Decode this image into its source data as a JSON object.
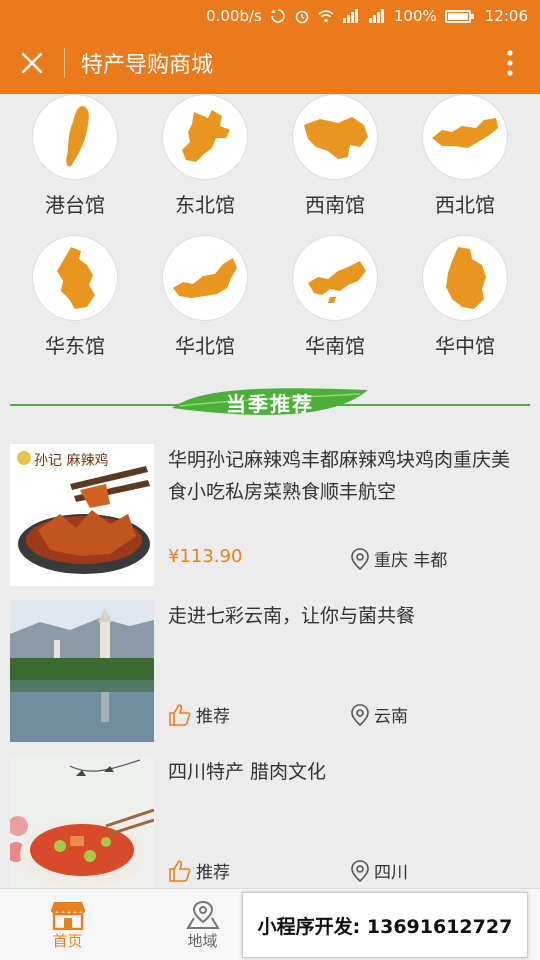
{
  "status_bar": {
    "speed": "0.00b/s",
    "battery": "100%",
    "time": "12:06"
  },
  "header": {
    "title": "特产导购商城",
    "background": "#ea7a1b"
  },
  "regions": [
    {
      "label": "港台馆",
      "icon": "taiwan-map-icon"
    },
    {
      "label": "东北馆",
      "icon": "northeast-map-icon"
    },
    {
      "label": "西南馆",
      "icon": "southwest-map-icon"
    },
    {
      "label": "西北馆",
      "icon": "northwest-map-icon"
    },
    {
      "label": "华东馆",
      "icon": "east-china-map-icon"
    },
    {
      "label": "华北馆",
      "icon": "north-china-map-icon"
    },
    {
      "label": "华南馆",
      "icon": "south-china-map-icon"
    },
    {
      "label": "华中馆",
      "icon": "central-china-map-icon"
    }
  ],
  "section": {
    "title": "当季推荐",
    "accent": "#4caf3a"
  },
  "products": [
    {
      "name": "华明孙记麻辣鸡丰都麻辣鸡块鸡肉重庆美食小吃私房菜熟食顺丰航空",
      "price": "¥113.90",
      "location": "重庆 丰都",
      "thumb_text": "孙记 麻辣鸡"
    },
    {
      "name": "走进七彩云南，让你与菌共餐",
      "tag": "推荐",
      "location": "云南"
    },
    {
      "name": "四川特产 腊肉文化",
      "tag": "推荐",
      "location": "四川"
    }
  ],
  "tabbar": {
    "tabs": [
      {
        "label": "首页",
        "icon": "shop-icon"
      },
      {
        "label": "地域",
        "icon": "map-pin-icon"
      }
    ],
    "active_color": "#e8801f"
  },
  "ad": {
    "text": "小程序开发:  13691612727"
  }
}
